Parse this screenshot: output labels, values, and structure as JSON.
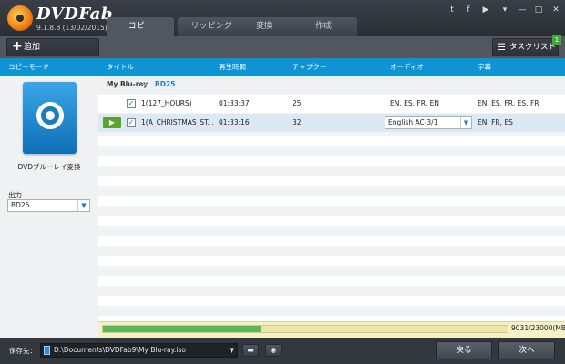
{
  "app": {
    "name": "DVDFab",
    "version": "9.1.8.8 (13/02/2015)"
  },
  "tabs": [
    {
      "label": "コピー",
      "active": true
    },
    {
      "label": "リッピング",
      "active": false
    },
    {
      "label": "変換",
      "active": false
    },
    {
      "label": "作成",
      "active": false
    }
  ],
  "header_icons": [
    "twitter-icon",
    "facebook-icon",
    "youtube-icon",
    "menu-icon",
    "minimize-icon",
    "maximize-icon",
    "close-icon"
  ],
  "header_glyphs": [
    "t",
    "f",
    "▶",
    "▾",
    "—",
    "□",
    "✕"
  ],
  "toolbar": {
    "add_label": "追加",
    "task_label": "タスクリスト",
    "task_count": "1"
  },
  "columns": {
    "mode": "コピーモード",
    "title": "タイトル",
    "duration": "再生時間",
    "chapters": "チャプクー",
    "audio": "オーディオ",
    "subtitles": "字幕"
  },
  "left_panel": {
    "mode_label": "DVDブルーレイ変換",
    "output_label": "出力",
    "output_value": "BD25"
  },
  "breadcrumb": {
    "root": "My Blu-ray",
    "leaf": "BD25"
  },
  "rows": [
    {
      "title": "1(127_HOURS)",
      "duration": "01:33:37",
      "chapters": "25",
      "audio": "EN, ES, FR, EN",
      "subtitles": "EN, ES, FR, ES, FR"
    },
    {
      "title": "1(A_CHRISTMAS_ST...",
      "duration": "01:33:16",
      "chapters": "32",
      "audio": "English AC-3/1",
      "subtitles": "EN, FR, ES"
    }
  ],
  "progress": {
    "text": "9031/23000(MB)",
    "fraction": 0.39
  },
  "bottom": {
    "save_label": "保存先：",
    "path": "D:\\Documents\\DVDFab9\\My Blu-ray.iso",
    "back_label": "戻る",
    "next_label": "次へ"
  },
  "colors": {
    "accent_blue": "#0e94d3",
    "progress_green": "#5cb85c",
    "play_green": "#5aa32c"
  }
}
